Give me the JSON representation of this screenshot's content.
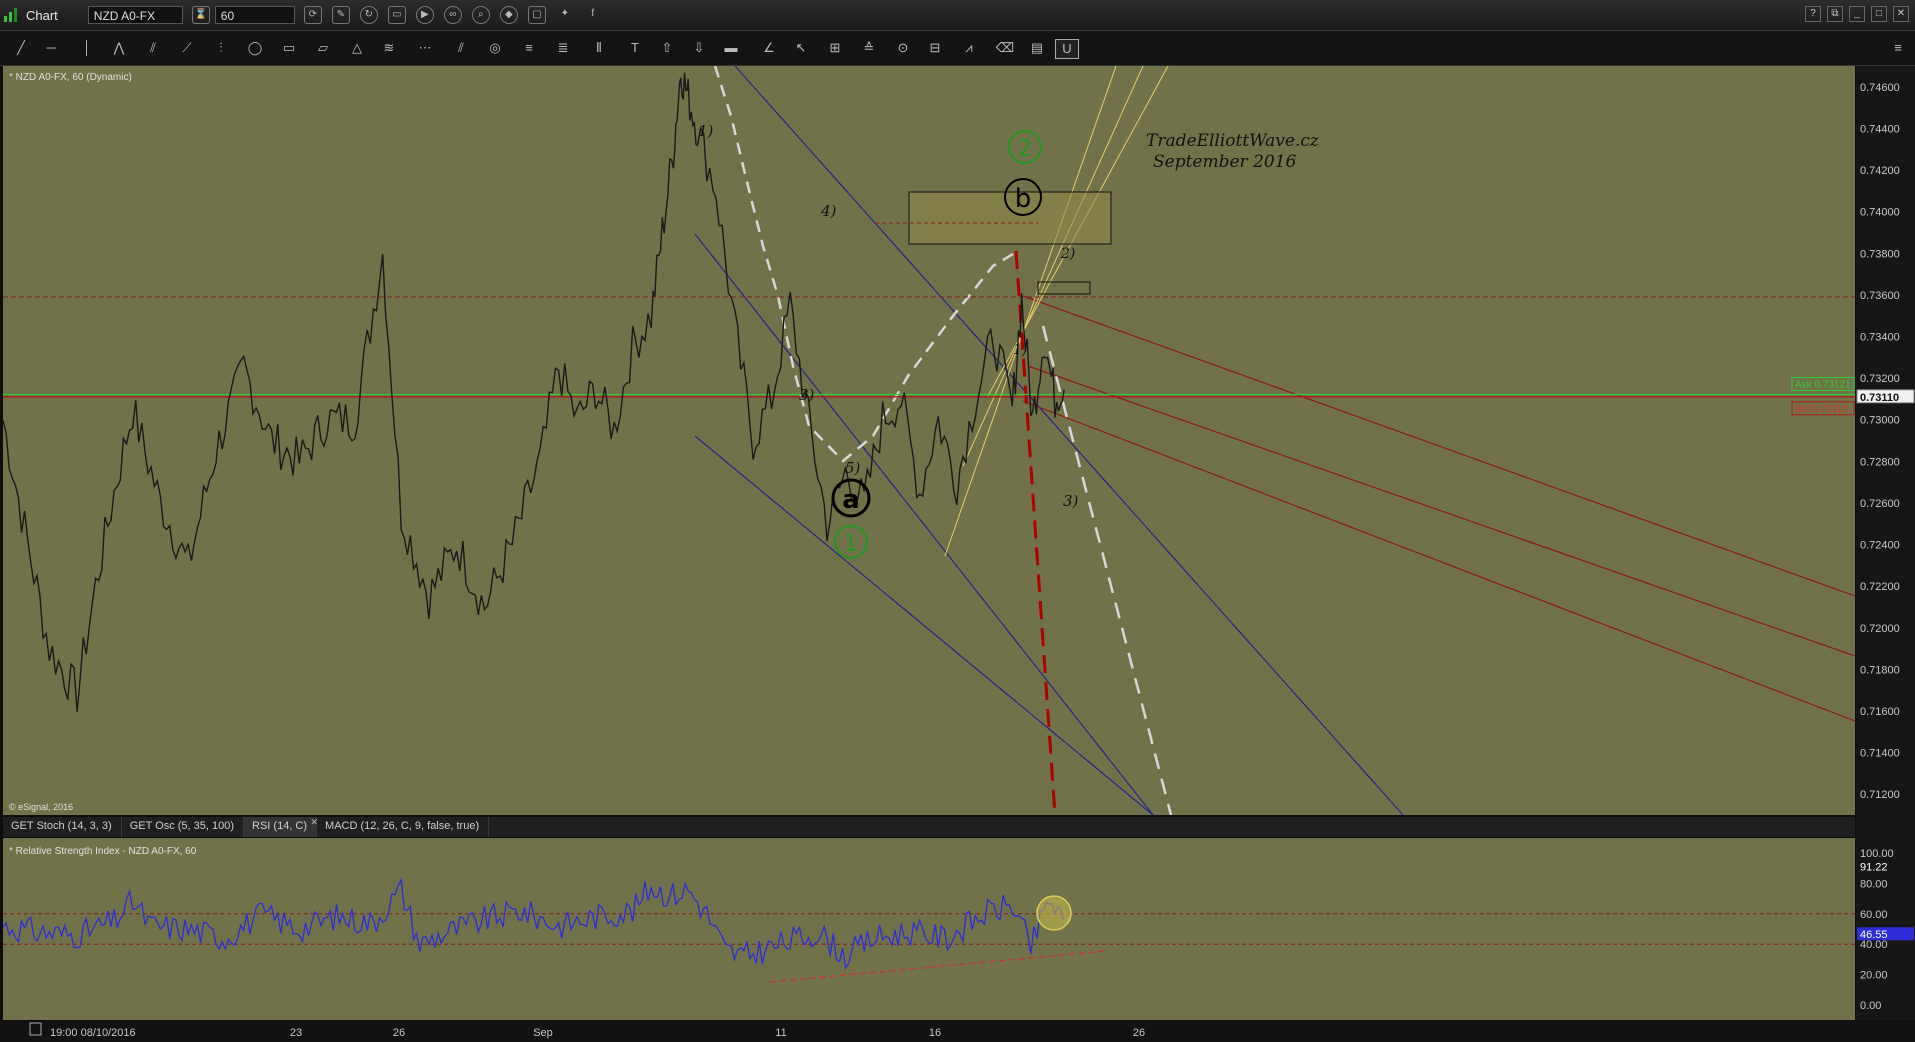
{
  "window": {
    "title": "Chart",
    "symbol": "NZD A0-FX",
    "interval": "60"
  },
  "main_pane": {
    "info": "* NZD A0-FX, 60 (Dynamic)",
    "copyright": "© eSignal, 2016",
    "watermark_line1": "TradeElliottWave.cz",
    "watermark_line2": "September   2016",
    "ask_label": "Ask 0.73121",
    "bid_label": "Bid 0.73110",
    "last_price": "0.73110"
  },
  "rsi_pane": {
    "info": "* Relative Strength Index - NZD A0-FX, 60",
    "value": "46.55",
    "high": "91.22"
  },
  "tabs": [
    "GET Stoch (14, 3, 3)",
    "GET Osc (5, 35, 100)",
    "RSI (14, C)",
    "MACD (12, 26, C, 9, false, true)"
  ],
  "active_tab_index": 2,
  "time_axis": {
    "start_label": "19:00 08/10/2016",
    "ticks": [
      "23",
      "26",
      "Sep",
      "11",
      "16",
      "26"
    ]
  },
  "wave_labels": {
    "w1": "1)",
    "w3": "3)",
    "w4": "4)",
    "w5": "5)",
    "c_a": "a",
    "c_b": "b",
    "g1": "1",
    "g2": "2",
    "s1": "1)",
    "s2": "2)",
    "s3": "3)"
  },
  "chart_data": {
    "type": "line",
    "instrument": "NZD A0-FX",
    "timeframe": "60",
    "price_axis": {
      "ylim": [
        0.711,
        0.747
      ],
      "ticks": [
        "0.74600",
        "0.74400",
        "0.74200",
        "0.74000",
        "0.73800",
        "0.73600",
        "0.73400",
        "0.73200",
        "0.73000",
        "0.72800",
        "0.72600",
        "0.72400",
        "0.72200",
        "0.72000",
        "0.71800",
        "0.71600",
        "0.71400",
        "0.71200"
      ]
    },
    "price_path": [
      [
        0,
        0.73
      ],
      [
        0.01,
        0.7255
      ],
      [
        0.025,
        0.719
      ],
      [
        0.04,
        0.7168
      ],
      [
        0.05,
        0.722
      ],
      [
        0.06,
        0.7265
      ],
      [
        0.07,
        0.7305
      ],
      [
        0.085,
        0.726
      ],
      [
        0.1,
        0.723
      ],
      [
        0.115,
        0.7285
      ],
      [
        0.13,
        0.7325
      ],
      [
        0.145,
        0.729
      ],
      [
        0.16,
        0.728
      ],
      [
        0.175,
        0.73
      ],
      [
        0.19,
        0.73
      ],
      [
        0.205,
        0.738
      ],
      [
        0.215,
        0.7255
      ],
      [
        0.23,
        0.7215
      ],
      [
        0.245,
        0.724
      ],
      [
        0.26,
        0.721
      ],
      [
        0.275,
        0.724
      ],
      [
        0.29,
        0.728
      ],
      [
        0.3,
        0.7325
      ],
      [
        0.31,
        0.73
      ],
      [
        0.32,
        0.7315
      ],
      [
        0.33,
        0.7295
      ],
      [
        0.34,
        0.7335
      ],
      [
        0.35,
        0.735
      ],
      [
        0.356,
        0.739
      ],
      [
        0.362,
        0.743
      ],
      [
        0.366,
        0.7468
      ],
      [
        0.37,
        0.7455
      ],
      [
        0.375,
        0.744
      ],
      [
        0.385,
        0.741
      ],
      [
        0.395,
        0.7345
      ],
      [
        0.405,
        0.729
      ],
      [
        0.415,
        0.731
      ],
      [
        0.425,
        0.7355
      ],
      [
        0.435,
        0.73
      ],
      [
        0.445,
        0.725
      ],
      [
        0.455,
        0.7275
      ],
      [
        0.465,
        0.726
      ],
      [
        0.475,
        0.73
      ],
      [
        0.485,
        0.731
      ],
      [
        0.495,
        0.7265
      ],
      [
        0.505,
        0.73
      ],
      [
        0.515,
        0.727
      ],
      [
        0.525,
        0.731
      ],
      [
        0.535,
        0.734
      ],
      [
        0.545,
        0.7305
      ],
      [
        0.55,
        0.7358
      ],
      [
        0.556,
        0.73
      ],
      [
        0.562,
        0.734
      ],
      [
        0.568,
        0.731
      ],
      [
        0.574,
        0.732
      ]
    ],
    "horizontal_lines": [
      {
        "name": "resistance",
        "price": 0.7359,
        "style": "dashed",
        "color": "#8b1a1a"
      },
      {
        "name": "ask",
        "price": 0.73121,
        "style": "solid",
        "color": "#33cc33"
      },
      {
        "name": "bid",
        "price": 0.7311,
        "style": "solid",
        "color": "#b01818"
      }
    ],
    "rsi": {
      "ylim": [
        0,
        100
      ],
      "ticks": [
        "100.00",
        "80.00",
        "60.00",
        "40.00",
        "20.00",
        "0.00"
      ],
      "levels": [
        60,
        40
      ],
      "last": 46.55,
      "max": 91.22,
      "path": [
        [
          0,
          52
        ],
        [
          0.02,
          48
        ],
        [
          0.04,
          46
        ],
        [
          0.06,
          55
        ],
        [
          0.07,
          68
        ],
        [
          0.08,
          52
        ],
        [
          0.1,
          50
        ],
        [
          0.12,
          44
        ],
        [
          0.14,
          60
        ],
        [
          0.16,
          50
        ],
        [
          0.18,
          58
        ],
        [
          0.2,
          54
        ],
        [
          0.215,
          76
        ],
        [
          0.225,
          40
        ],
        [
          0.24,
          48
        ],
        [
          0.26,
          56
        ],
        [
          0.28,
          62
        ],
        [
          0.3,
          52
        ],
        [
          0.32,
          58
        ],
        [
          0.34,
          62
        ],
        [
          0.35,
          78
        ],
        [
          0.36,
          72
        ],
        [
          0.37,
          76
        ],
        [
          0.38,
          60
        ],
        [
          0.39,
          36
        ],
        [
          0.4,
          32
        ],
        [
          0.42,
          40
        ],
        [
          0.44,
          48
        ],
        [
          0.455,
          32
        ],
        [
          0.47,
          44
        ],
        [
          0.49,
          48
        ],
        [
          0.51,
          44
        ],
        [
          0.53,
          60
        ],
        [
          0.545,
          66
        ],
        [
          0.555,
          38
        ],
        [
          0.565,
          70
        ],
        [
          0.574,
          50
        ]
      ]
    }
  },
  "colors": {
    "pane_bg": "#71714a",
    "price_line": "#1a1a1a",
    "rsi_line": "#2d2dd8",
    "channel_blue": "#24248a",
    "channel_red": "#8b1a1a",
    "fan_yellow": "#e8cc6a",
    "wave_green": "#1f9a1f"
  }
}
